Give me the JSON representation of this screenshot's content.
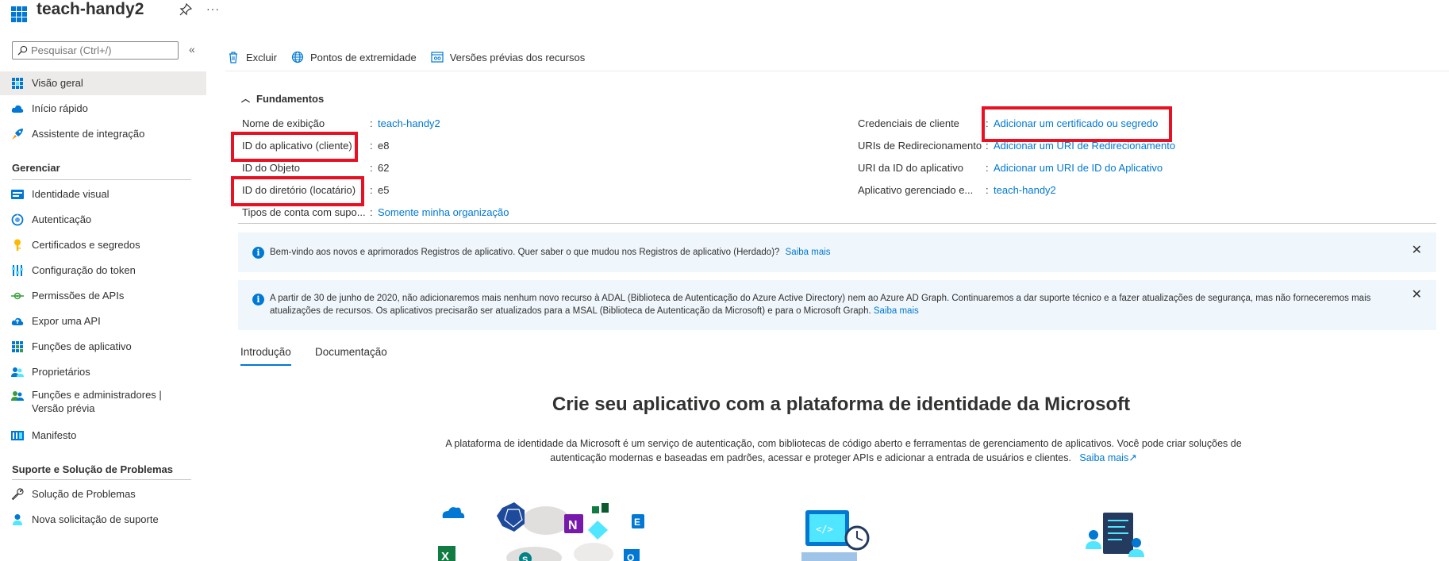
{
  "header": {
    "title": "teach-handy2",
    "more": "···"
  },
  "sidebar": {
    "search": {
      "placeholder": "Pesquisar (Ctrl+/)",
      "value": ""
    },
    "collapse": "«",
    "items": [
      {
        "label": "Visão geral",
        "icon": "overview-icon",
        "active": true
      },
      {
        "label": "Início rápido",
        "icon": "quickstart-cloud-icon"
      },
      {
        "label": "Assistente de integração",
        "icon": "rocket-icon"
      }
    ],
    "manage_header": "Gerenciar",
    "manage_items": [
      {
        "label": "Identidade visual",
        "icon": "branding-icon"
      },
      {
        "label": "Autenticação",
        "icon": "authentication-icon"
      },
      {
        "label": "Certificados e segredos",
        "icon": "key-icon"
      },
      {
        "label": "Configuração do token",
        "icon": "token-config-icon"
      },
      {
        "label": "Permissões de APIs",
        "icon": "api-permissions-icon"
      },
      {
        "label": "Expor uma API",
        "icon": "expose-api-cloud-icon"
      },
      {
        "label": "Funções de aplicativo",
        "icon": "app-roles-icon"
      },
      {
        "label": "Proprietários",
        "icon": "owners-icon"
      },
      {
        "label": "Funções e administradores |",
        "label2": "Versão prévia",
        "icon": "roles-admins-icon"
      },
      {
        "label": "Manifesto",
        "icon": "manifest-icon"
      }
    ],
    "support_header": "Suporte e Solução de Problemas",
    "support_items": [
      {
        "label": "Solução de Problemas",
        "icon": "wrench-icon"
      },
      {
        "label": "Nova solicitação de suporte",
        "icon": "support-person-icon"
      }
    ]
  },
  "toolbar": {
    "delete": "Excluir",
    "endpoints": "Pontos de extremidade",
    "preview": "Versões prévias dos recursos"
  },
  "essentials": {
    "title": "Fundamentos",
    "left": [
      {
        "label": "Nome de exibição",
        "value": "teach-handy2",
        "link": true
      },
      {
        "label": "ID do aplicativo (cliente)",
        "value": "e8"
      },
      {
        "label": "ID do Objeto",
        "value": "62"
      },
      {
        "label": "ID do diretório (locatário)",
        "value": "e5"
      },
      {
        "label": "Tipos de conta com supo...",
        "value": "Somente minha organização",
        "link": true
      }
    ],
    "right": [
      {
        "label": "Credenciais de cliente",
        "value": "Adicionar um certificado ou segredo"
      },
      {
        "label": "URIs de Redirecionamento",
        "value": "Adicionar um URI de Redirecionamento"
      },
      {
        "label": "URI da ID do aplicativo",
        "value": "Adicionar um URI de ID do Aplicativo"
      },
      {
        "label": "Aplicativo gerenciado e...",
        "value": "teach-handy2"
      }
    ],
    "colon": ":"
  },
  "banners": [
    {
      "text": "Bem-vindo aos novos e aprimorados Registros de aplicativo. Quer saber o que mudou nos Registros de aplicativo (Herdado)?",
      "link": "Saiba mais"
    },
    {
      "text": "A partir de 30 de junho de 2020, não adicionaremos mais nenhum novo recurso à ADAL (Biblioteca de Autenticação do Azure Active Directory) nem ao Azure AD Graph. Continuaremos a dar suporte técnico e a fazer atualizações de segurança, mas não forneceremos mais",
      "text2": "atualizações de recursos. Os aplicativos precisarão ser atualizados para a MSAL (Biblioteca de Autenticação da Microsoft) e para o Microsoft Graph.",
      "link": "Saiba mais"
    }
  ],
  "tabs": [
    "Introdução",
    "Documentação"
  ],
  "hero": {
    "title": "Crie seu aplicativo com a plataforma de identidade da Microsoft",
    "text1": "A plataforma de identidade da Microsoft é um serviço de autenticação, com bibliotecas de código aberto e ferramentas de gerenciamento de aplicativos. Você pode criar soluções de",
    "text2": "autenticação modernas e baseadas em padrões, acessar e proteger APIs e adicionar a entrada de usuários e clientes.",
    "link": "Saiba mais"
  },
  "colors": {
    "accent": "#0078d4",
    "highlight_box": "#e81123",
    "banner_bg": "#eff6fc"
  }
}
